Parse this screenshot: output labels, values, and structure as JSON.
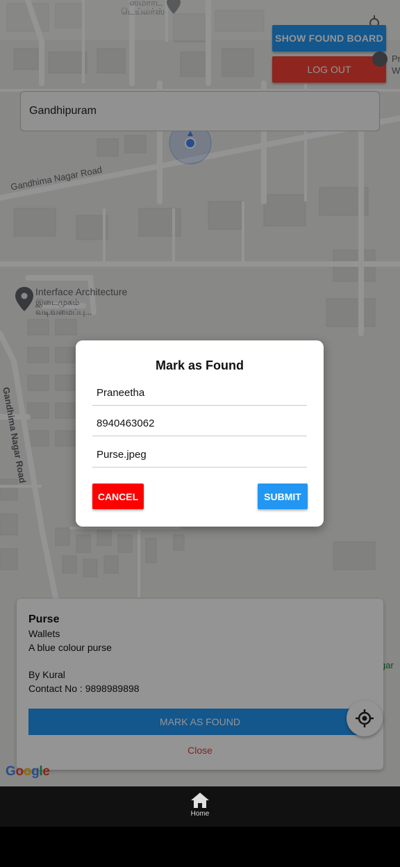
{
  "header": {
    "show_found_board_label": "SHOW FOUND BOARD",
    "logout_label": "LOG OUT"
  },
  "search": {
    "value": "Gandhipuram"
  },
  "map": {
    "labels": {
      "top_tamil_1": "ஸ்மார்ட்",
      "top_tamil_2": "டெய்லர்ஸ்",
      "road_1": "Gandhima Nagar Road",
      "road_2": "Gandhima Nagar Road",
      "poi_name": "Interface Architecture",
      "poi_tamil_1": "இடைமுகம்",
      "poi_tamil_2": "வடிவமைப்பு...",
      "right_edge_1": "Pr",
      "right_edge_2": "W",
      "right_green": "gar"
    },
    "attribution": "Google",
    "google_colors": [
      "#4285F4",
      "#EA4335",
      "#FBBC05",
      "#4285F4",
      "#34A853",
      "#EA4335"
    ]
  },
  "info_card": {
    "title": "Purse",
    "category": "Wallets",
    "description": "A blue colour purse",
    "by": "By Kural",
    "contact": "Contact No : 9898989898",
    "mark_label": "MARK AS FOUND",
    "close_label": "Close"
  },
  "dialog": {
    "title": "Mark as Found",
    "name_value": "Praneetha",
    "phone_value": "8940463062",
    "file_value": "Purse.jpeg",
    "cancel_label": "CANCEL",
    "submit_label": "SUBMIT"
  },
  "tabbar": {
    "home_label": "Home",
    "home_icon": "home-icon"
  },
  "colors": {
    "primary": "#2196F3",
    "danger": "#F44336",
    "cancel_red": "#FF0000",
    "close_red": "#E53935"
  }
}
